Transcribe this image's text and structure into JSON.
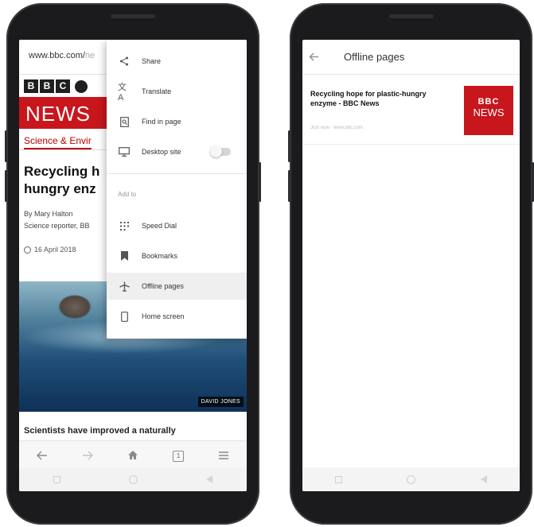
{
  "left_phone": {
    "url": "www.bbc.com/",
    "url_suffix": "ne",
    "bbc_letters": [
      "B",
      "B",
      "C"
    ],
    "news_word": "NEWS",
    "section": "Science & Envir",
    "headline_line1": "Recycling h",
    "headline_line2": "hungry enz",
    "byline_author": "By Mary Halton",
    "byline_role": "Science reporter, BB",
    "date": "16 April 2018",
    "photo_credit": "DAVID JONES",
    "summary": "Scientists have improved a naturally",
    "menu": {
      "items": [
        {
          "label": "Share",
          "icon": "share-icon"
        },
        {
          "label": "Translate",
          "icon": "translate-icon"
        },
        {
          "label": "Find in page",
          "icon": "find-in-page-icon"
        },
        {
          "label": "Desktop site",
          "icon": "desktop-icon"
        }
      ],
      "add_to_heading": "Add to",
      "add_to_items": [
        {
          "label": "Speed Dial",
          "icon": "speed-dial-icon"
        },
        {
          "label": "Bookmarks",
          "icon": "bookmark-icon"
        },
        {
          "label": "Offline pages",
          "icon": "airplane-icon"
        },
        {
          "label": "Home screen",
          "icon": "phone-icon"
        }
      ],
      "active_item": "Offline pages",
      "desktop_site_enabled": false
    },
    "browser_nav_icons": [
      "back-arrow-icon",
      "forward-arrow-icon",
      "home-icon",
      "tabs-icon",
      "menu-icon"
    ],
    "tab_count": "1"
  },
  "right_phone": {
    "title": "Offline pages",
    "card": {
      "title": "Recycling hope for plastic-hungry enzyme - BBC News",
      "meta": "Just now · www.bbc.com",
      "thumb_top": "BBC",
      "thumb_bottom": "NEWS"
    }
  },
  "colors": {
    "bbc_red": "#c8161d",
    "phone_body": "#1b1b1d"
  }
}
